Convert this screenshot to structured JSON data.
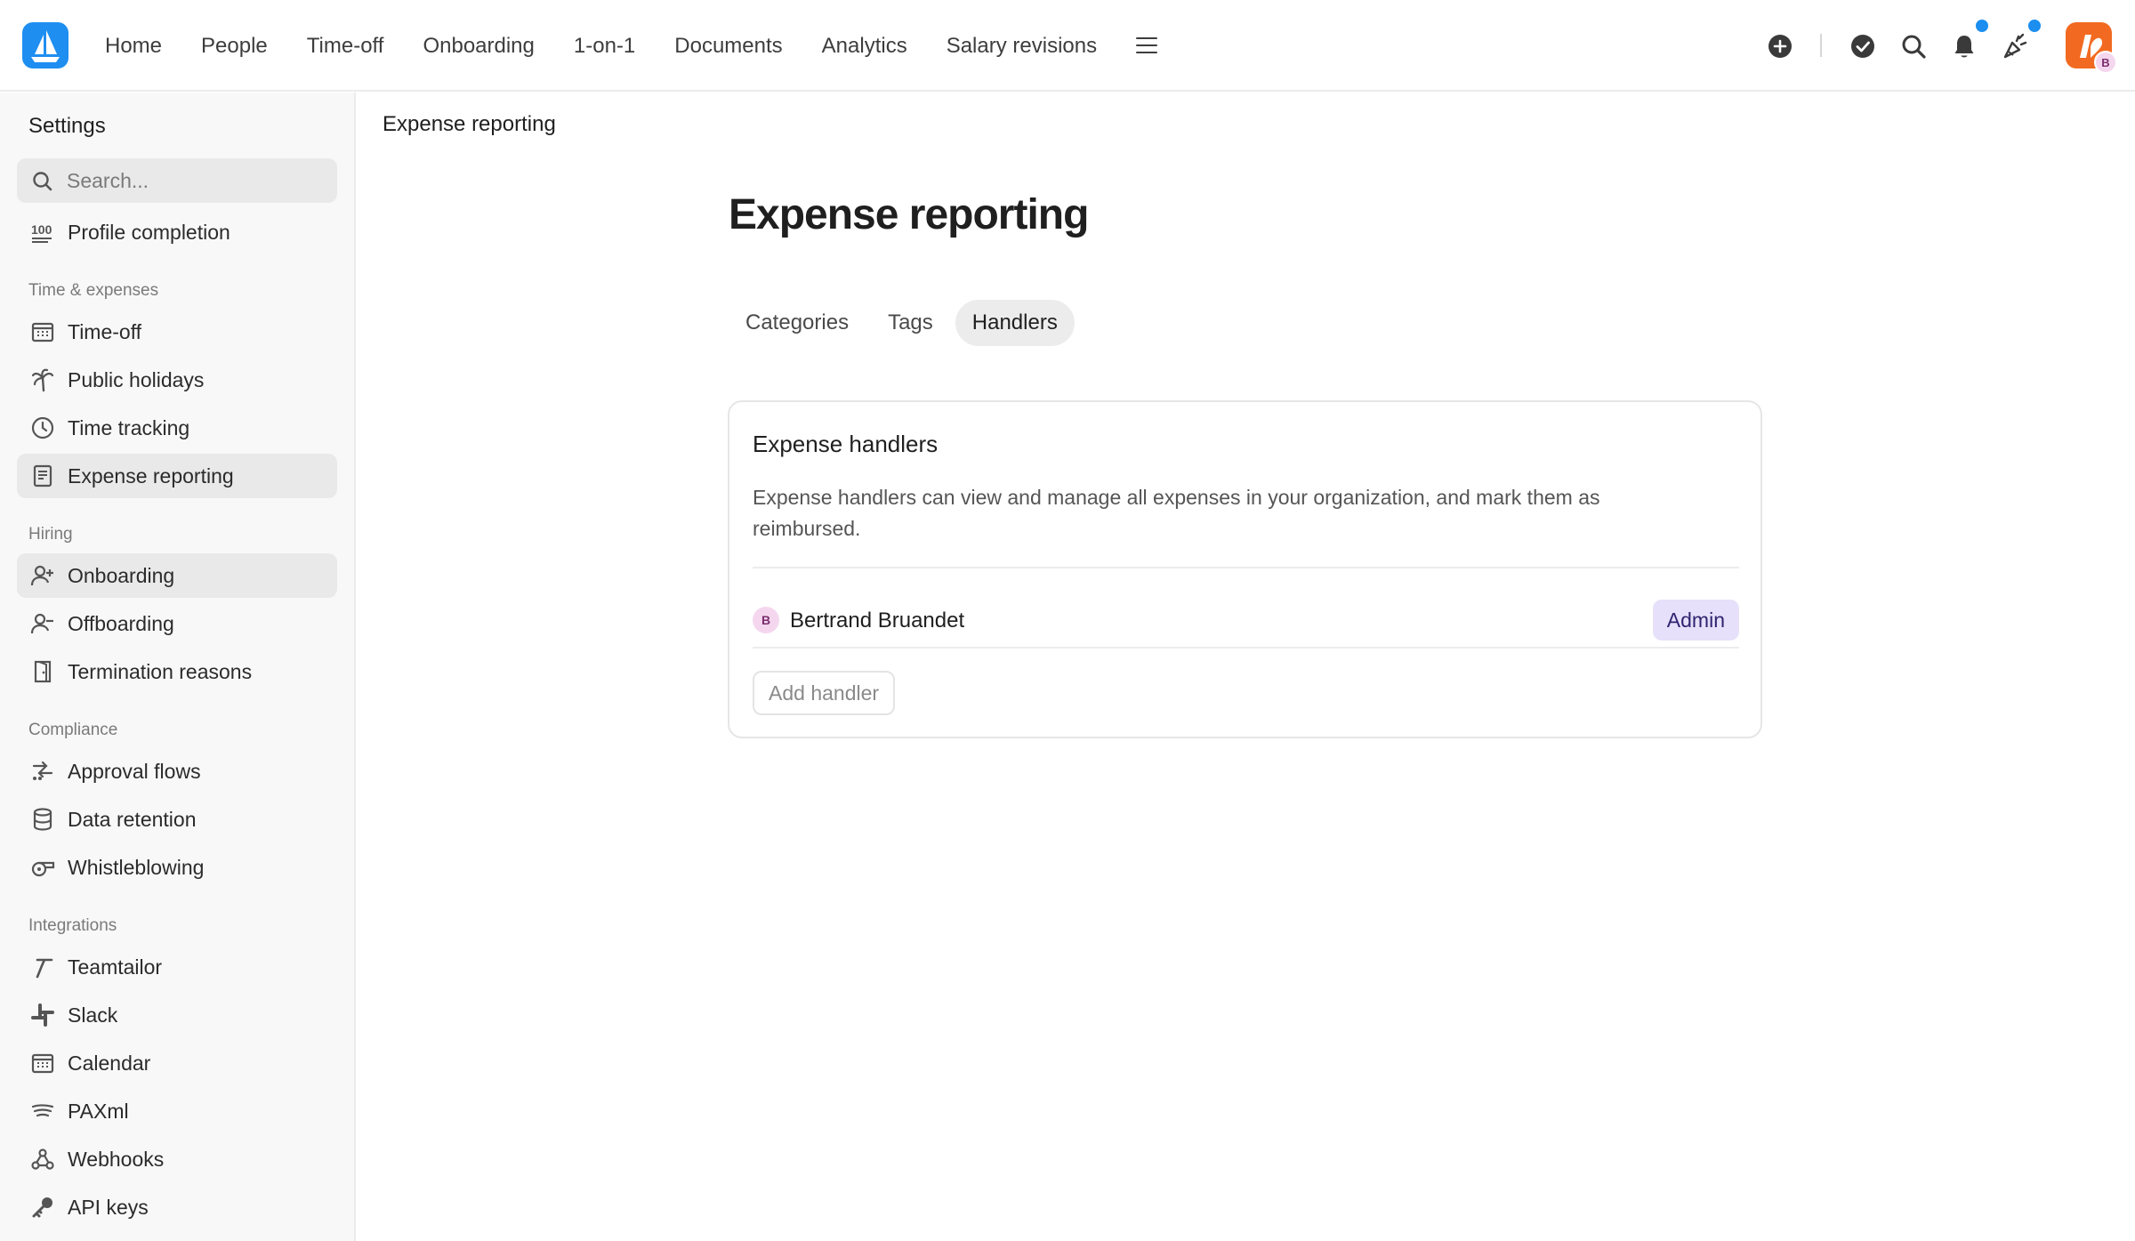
{
  "topbar": {
    "nav": [
      "Home",
      "People",
      "Time-off",
      "Onboarding",
      "1-on-1",
      "Documents",
      "Analytics",
      "Salary revisions"
    ],
    "user_initial": "B",
    "notification_dot_color": "#1b8ef0",
    "app_logo_color": "#1f8ef1",
    "user_logo_color": "#f26a21"
  },
  "sidebar": {
    "title": "Settings",
    "search_placeholder": "Search...",
    "top_items": [
      {
        "label": "Profile completion",
        "icon": "hundred-icon"
      }
    ],
    "sections": [
      {
        "title": "Time & expenses",
        "items": [
          {
            "label": "Time-off",
            "icon": "calendar-icon"
          },
          {
            "label": "Public holidays",
            "icon": "palm-tree-icon"
          },
          {
            "label": "Time tracking",
            "icon": "clock-icon"
          },
          {
            "label": "Expense reporting",
            "icon": "receipt-icon",
            "active": true
          }
        ]
      },
      {
        "title": "Hiring",
        "items": [
          {
            "label": "Onboarding",
            "icon": "user-plus-icon",
            "hover": true
          },
          {
            "label": "Offboarding",
            "icon": "user-minus-icon"
          },
          {
            "label": "Termination reasons",
            "icon": "door-icon"
          }
        ]
      },
      {
        "title": "Compliance",
        "items": [
          {
            "label": "Approval flows",
            "icon": "flow-icon"
          },
          {
            "label": "Data retention",
            "icon": "database-icon"
          },
          {
            "label": "Whistleblowing",
            "icon": "whistle-icon"
          }
        ]
      },
      {
        "title": "Integrations",
        "items": [
          {
            "label": "Teamtailor",
            "icon": "teamtailor-icon"
          },
          {
            "label": "Slack",
            "icon": "slack-icon"
          },
          {
            "label": "Calendar",
            "icon": "calendar-icon"
          },
          {
            "label": "PAXml",
            "icon": "paxml-icon"
          },
          {
            "label": "Webhooks",
            "icon": "webhook-icon"
          },
          {
            "label": "API keys",
            "icon": "key-icon"
          }
        ]
      }
    ]
  },
  "main": {
    "breadcrumb": "Expense reporting",
    "title": "Expense reporting",
    "tabs": [
      {
        "label": "Categories"
      },
      {
        "label": "Tags"
      },
      {
        "label": "Handlers",
        "active": true
      }
    ],
    "card": {
      "title": "Expense handlers",
      "description": "Expense handlers can view and manage all expenses in your organization, and mark them as reimbursed.",
      "handlers": [
        {
          "initial": "B",
          "name": "Bertrand Bruandet",
          "role": "Admin"
        }
      ],
      "add_label": "Add handler",
      "role_color": "#e6e0fa"
    }
  }
}
